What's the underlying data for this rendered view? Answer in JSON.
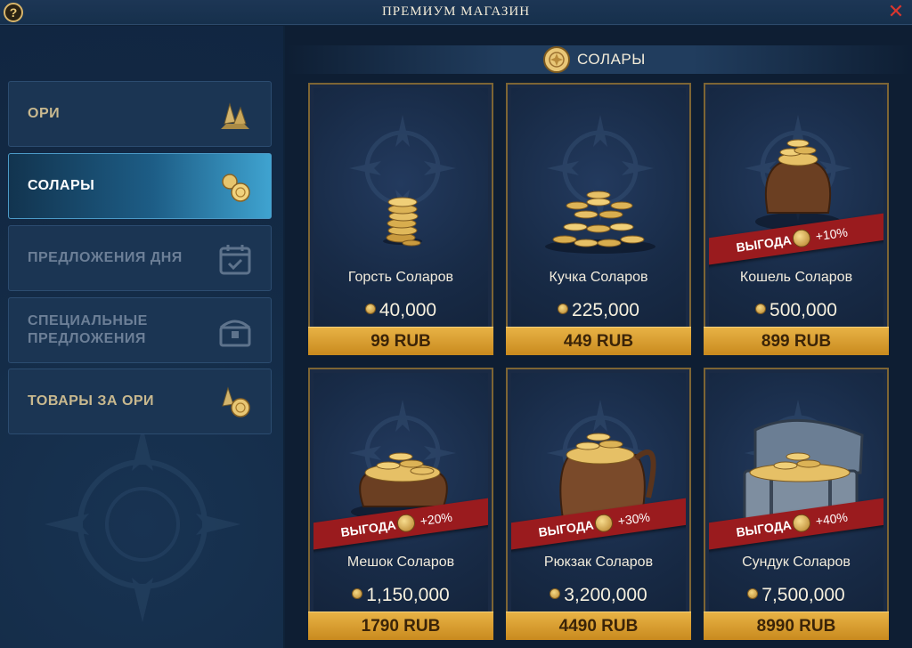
{
  "window": {
    "title": "ПРЕМИУМ МАГАЗИН",
    "help_icon": "help-icon",
    "close_icon": "close-icon",
    "close_glyph": "✕"
  },
  "sidebar": {
    "items": [
      {
        "label": "ОРИ",
        "icon": "ori-crystal-icon",
        "state": "normal"
      },
      {
        "label": "СОЛАРЫ",
        "icon": "solar-coins-icon",
        "state": "active"
      },
      {
        "label": "ПРЕДЛОЖЕНИЯ ДНЯ",
        "icon": "calendar-icon",
        "state": "disabled"
      },
      {
        "label": "СПЕЦИАЛЬНЫЕ ПРЕДЛОЖЕНИЯ",
        "icon": "chest-icon",
        "state": "disabled"
      },
      {
        "label": "ТОВАРЫ ЗА ОРИ",
        "icon": "ori-goods-icon",
        "state": "normal"
      }
    ]
  },
  "section": {
    "title": "СОЛАРЫ",
    "icon": "solar-coin-icon"
  },
  "products": [
    {
      "name": "Горсть Соларов",
      "amount": "40,000",
      "price": "99 RUB",
      "bonus_label": "",
      "bonus": ""
    },
    {
      "name": "Кучка Соларов",
      "amount": "225,000",
      "price": "449 RUB",
      "bonus_label": "",
      "bonus": ""
    },
    {
      "name": "Кошель Соларов",
      "amount": "500,000",
      "price": "899 RUB",
      "bonus_label": "ВЫГОДА",
      "bonus": "+10%"
    },
    {
      "name": "Мешок Соларов",
      "amount": "1,150,000",
      "price": "1790 RUB",
      "bonus_label": "ВЫГОДА",
      "bonus": "+20%"
    },
    {
      "name": "Рюкзак Соларов",
      "amount": "3,200,000",
      "price": "4490 RUB",
      "bonus_label": "ВЫГОДА",
      "bonus": "+30%"
    },
    {
      "name": "Сундук Соларов",
      "amount": "7,500,000",
      "price": "8990 RUB",
      "bonus_label": "ВЫГОДА",
      "bonus": "+40%"
    }
  ],
  "colors": {
    "accent_gold": "#e8b245",
    "ribbon_red": "#9a1b1e",
    "active_blue": "#3fa3d0",
    "close_red": "#d9362e"
  }
}
